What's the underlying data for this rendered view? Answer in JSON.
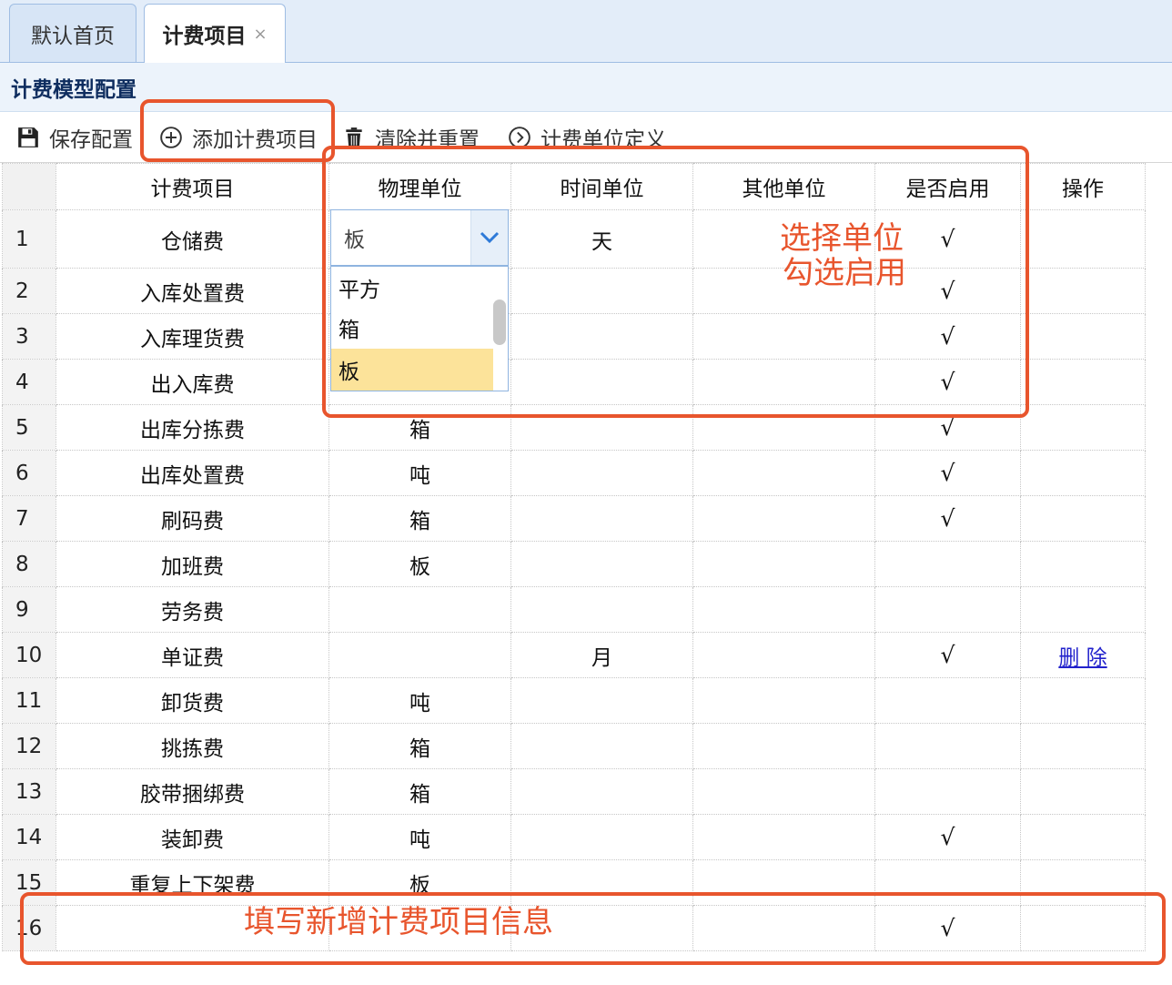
{
  "tabs": [
    {
      "label": "默认首页",
      "active": false
    },
    {
      "label": "计费项目",
      "active": true,
      "close": "×"
    }
  ],
  "panel_title": "计费模型配置",
  "toolbar": {
    "save_label": "保存配置",
    "add_label": "添加计费项目",
    "clear_label": "清除并重置",
    "unit_def_label": "计费单位定义"
  },
  "columns": [
    "计费项目",
    "物理单位",
    "时间单位",
    "其他单位",
    "是否启用",
    "操作"
  ],
  "rows": [
    {
      "no": "1",
      "item": "仓储费",
      "physical": "",
      "time": "天",
      "other": "",
      "enabled": "√",
      "action": ""
    },
    {
      "no": "2",
      "item": "入库处置费",
      "physical": "",
      "time": "",
      "other": "",
      "enabled": "√",
      "action": ""
    },
    {
      "no": "3",
      "item": "入库理货费",
      "physical": "",
      "time": "",
      "other": "",
      "enabled": "√",
      "action": ""
    },
    {
      "no": "4",
      "item": "出入库费",
      "physical": "",
      "time": "",
      "other": "",
      "enabled": "√",
      "action": ""
    },
    {
      "no": "5",
      "item": "出库分拣费",
      "physical": "箱",
      "time": "",
      "other": "",
      "enabled": "√",
      "action": ""
    },
    {
      "no": "6",
      "item": "出库处置费",
      "physical": "吨",
      "time": "",
      "other": "",
      "enabled": "√",
      "action": ""
    },
    {
      "no": "7",
      "item": "刷码费",
      "physical": "箱",
      "time": "",
      "other": "",
      "enabled": "√",
      "action": ""
    },
    {
      "no": "8",
      "item": "加班费",
      "physical": "板",
      "time": "",
      "other": "",
      "enabled": "",
      "action": ""
    },
    {
      "no": "9",
      "item": "劳务费",
      "physical": "",
      "time": "",
      "other": "",
      "enabled": "",
      "action": ""
    },
    {
      "no": "10",
      "item": "单证费",
      "physical": "",
      "time": "月",
      "other": "",
      "enabled": "√",
      "action": "删 除"
    },
    {
      "no": "11",
      "item": "卸货费",
      "physical": "吨",
      "time": "",
      "other": "",
      "enabled": "",
      "action": ""
    },
    {
      "no": "12",
      "item": "挑拣费",
      "physical": "箱",
      "time": "",
      "other": "",
      "enabled": "",
      "action": ""
    },
    {
      "no": "13",
      "item": "胶带捆绑费",
      "physical": "箱",
      "time": "",
      "other": "",
      "enabled": "",
      "action": ""
    },
    {
      "no": "14",
      "item": "装卸费",
      "physical": "吨",
      "time": "",
      "other": "",
      "enabled": "√",
      "action": ""
    },
    {
      "no": "15",
      "item": "重复上下架费",
      "physical": "板",
      "time": "",
      "other": "",
      "enabled": "",
      "action": ""
    },
    {
      "no": "16",
      "item": "",
      "physical": "",
      "time": "",
      "other": "",
      "enabled": "√",
      "action": ""
    }
  ],
  "unit_select": {
    "value": "板",
    "options": [
      "平方",
      "箱",
      "板"
    ],
    "selected_index": 2
  },
  "annotations": {
    "select_unit": "选择单位",
    "check_enable": "勾选启用",
    "fill_new": "填写新增计费项目信息"
  },
  "colors": {
    "highlight": "#e8552d",
    "link": "#2222cc",
    "selected_option": "#fce39a"
  }
}
